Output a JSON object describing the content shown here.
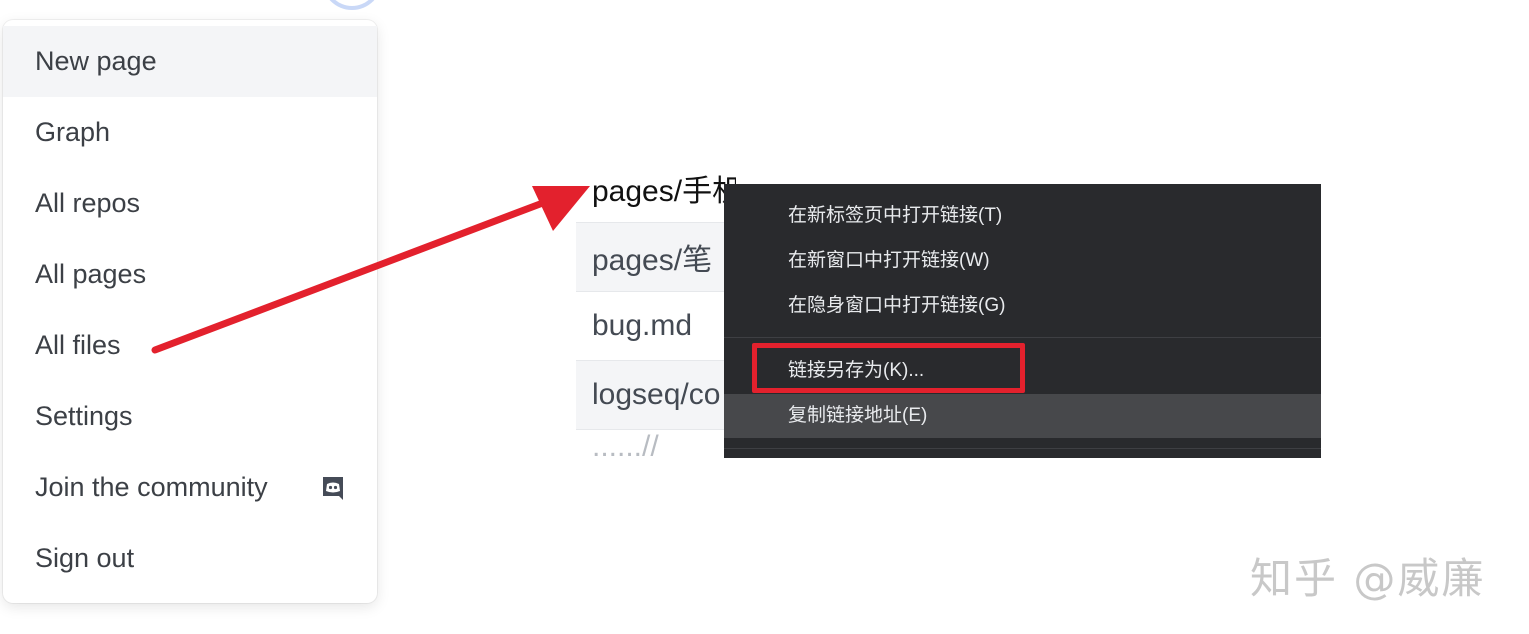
{
  "menu": {
    "items": [
      {
        "label": "New page"
      },
      {
        "label": "Graph"
      },
      {
        "label": "All repos"
      },
      {
        "label": "All pages"
      },
      {
        "label": "All files"
      },
      {
        "label": "Settings"
      },
      {
        "label": "Join the community",
        "icon": "discord-icon"
      },
      {
        "label": "Sign out"
      }
    ]
  },
  "files": {
    "rows": [
      {
        "label": "pages/手机浏览器.md"
      },
      {
        "label": "pages/笔"
      },
      {
        "label": "bug.md"
      },
      {
        "label": "logseq/co"
      },
      {
        "label": "......//"
      }
    ]
  },
  "context_menu": {
    "items": [
      {
        "label": "在新标签页中打开链接(T)"
      },
      {
        "label": "在新窗口中打开链接(W)"
      },
      {
        "label": "在隐身窗口中打开链接(G)"
      },
      {
        "label": "链接另存为(K)..."
      },
      {
        "label": "复制链接地址(E)"
      }
    ]
  },
  "annotation": {
    "color": "#e3212d"
  },
  "watermark": {
    "text": "知乎 @威廉"
  }
}
